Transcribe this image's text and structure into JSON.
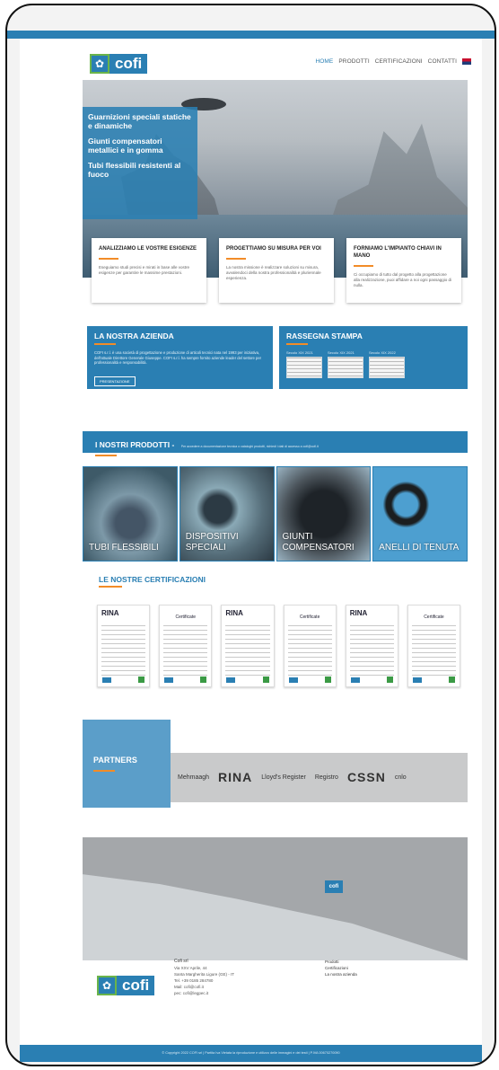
{
  "header": {
    "logo_text": "cofi",
    "nav": [
      {
        "label": "HOME",
        "active": true
      },
      {
        "label": "PRODOTTI",
        "active": false
      },
      {
        "label": "CERTIFICAZIONI",
        "active": false
      },
      {
        "label": "CONTATTI",
        "active": false
      }
    ]
  },
  "hero": {
    "lines": [
      "Guarnizioni speciali statiche e dinamiche",
      "Giunti compensatori metallici e in gomma",
      "Tubi flessibili resistenti al fuoco"
    ],
    "cards": [
      {
        "title": "ANALIZZIAMO LE VOSTRE ESIGENZE",
        "text": "Eseguiamo studi precisi e mirati in base alle vostre esigenze per garantire le massime prestazioni."
      },
      {
        "title": "PROGETTIAMO SU MISURA PER VOI",
        "text": "La nostra missione è realizzare soluzioni su misura, avvalendoci della nostra professionalità e pluriennale esperienza."
      },
      {
        "title": "FORNIAMO L'IMPIANTO CHIAVI IN MANO",
        "text": "Ci occupiamo di tutto dal progetto alla progettazione alla realizzazione, puoi affidare a noi ogni passaggio di nulla."
      }
    ]
  },
  "azienda": {
    "title": "LA NOSTRA AZIENDA",
    "text": "COFI s.r.l. è una società di progettazione e produzione di articoli tecnici nata nel 1993 per iniziativa, dell'attuale Direttore Generale Giuseppe. COFI s.r.l. ha sempre fornito aziende leader del settore per professionalità e responsabilità.",
    "button": "PRESENTAZIONE"
  },
  "rassegna": {
    "title": "RASSEGNA STAMPA",
    "items": [
      {
        "label": "Secolo XIX 2021"
      },
      {
        "label": "Secolo XIX 2021"
      },
      {
        "label": "Secolo XIX 2022"
      }
    ]
  },
  "prodotti": {
    "title": "I NOSTRI PRODOTTI -",
    "subtitle": "Per accedere a documentazione tecnica o cataloghi prodotti, richiedi i dati di accesso a cofi@cofi.it",
    "items": [
      {
        "label": "TUBI FLESSIBILI"
      },
      {
        "label": "DISPOSITIVI SPECIALI"
      },
      {
        "label": "GIUNTI COMPENSATORI"
      },
      {
        "label": "ANELLI DI TENUTA"
      }
    ]
  },
  "certificazioni": {
    "title": "LE NOSTRE CERTIFICAZIONI",
    "items": [
      "RINA",
      "Certificate",
      "RINA",
      "Certificate",
      "RINA",
      "Certificate"
    ]
  },
  "partners": {
    "title": "PARTNERS",
    "logos": [
      "Mehmaagh",
      "RINA",
      "Lloyd's Register",
      "Registro",
      "CSSN",
      "cnlo"
    ]
  },
  "map": {
    "marker": "cofi"
  },
  "footer": {
    "company": "Cofi srl",
    "address": "Via XXV Aprile, 44",
    "city": "Santa Margherita Ligure (GE) - IT",
    "tel": "Tel. +39 0185 284780",
    "email": "Mail: cofi@cofi.it",
    "pec": "pec: cofi@legpec.it",
    "links": [
      "Prodotti",
      "Certificazioni",
      "La nostra azienda"
    ],
    "copyright": "© Copyright 2022 COFI srl | Partita Iva Vietata la riproduzione e utilizzo delle immagini e dei testi | P.IVA 00670270090"
  }
}
